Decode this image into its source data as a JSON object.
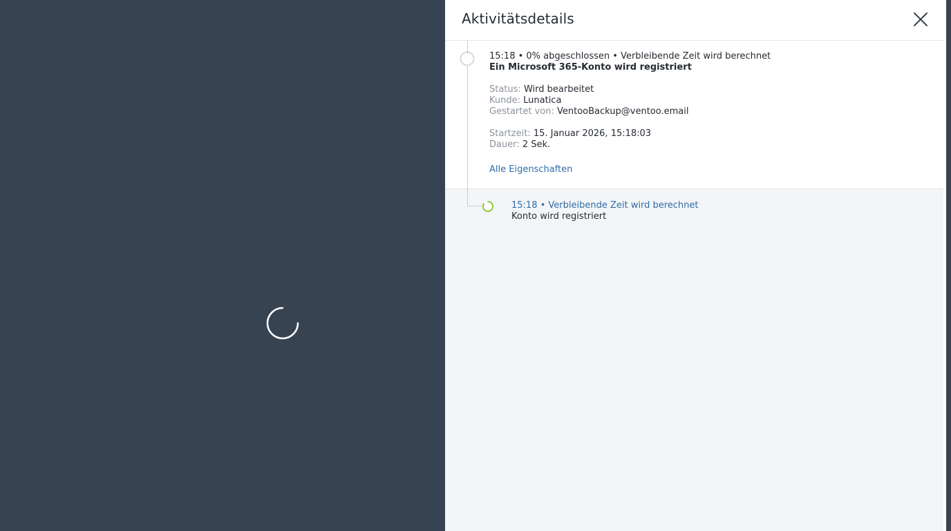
{
  "panel": {
    "title": "Aktivitätsdetails"
  },
  "activity": {
    "summary": "15:18 • 0% abgeschlossen • Verbleibende Zeit wird berechnet",
    "progress_percent": 0,
    "title": "Ein Microsoft 365-Konto wird registriert",
    "status_label": "Status:",
    "status_value": "Wird bearbeitet",
    "customer_label": "Kunde:",
    "customer_value": "Lunatica",
    "started_by_label": "Gestartet von:",
    "started_by_value": "VentooBackup@ventoo.email",
    "start_time_label": "Startzeit:",
    "start_time_value": "15. Januar 2026, 15:18:03",
    "duration_label": "Dauer:",
    "duration_value": "2 Sek.",
    "all_properties_link": "Alle Eigenschaften"
  },
  "subactivity": {
    "summary": "15:18 • Verbleibende Zeit wird berechnet",
    "title": "Konto wird registriert"
  },
  "colors": {
    "accent_green": "#8cc63f",
    "link_blue": "#2f6ca8",
    "backdrop": "#384352"
  },
  "icons": {
    "close": "close-icon",
    "loading": "loading-spinner-icon"
  }
}
